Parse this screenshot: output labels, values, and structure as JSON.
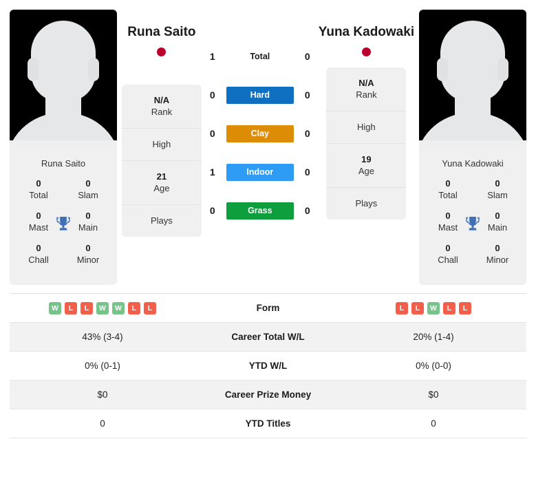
{
  "players": {
    "left": {
      "name": "Runa Saito",
      "photo_caption": "Runa Saito",
      "flag_name": "japan-flag",
      "flag_color": "#bc002d",
      "titles": [
        {
          "num": "0",
          "label": "Total"
        },
        {
          "num": "0",
          "label": "Slam"
        },
        {
          "num": "0",
          "label": "Mast"
        },
        {
          "num": "0",
          "label": "Main"
        },
        {
          "num": "0",
          "label": "Chall"
        },
        {
          "num": "0",
          "label": "Minor"
        }
      ],
      "info": [
        {
          "value": "N/A",
          "label": "Rank"
        },
        {
          "value": "",
          "label": "High"
        },
        {
          "value": "21",
          "label": "Age"
        },
        {
          "value": "",
          "label": "Plays"
        }
      ]
    },
    "right": {
      "name": "Yuna Kadowaki",
      "photo_caption": "Yuna Kadowaki",
      "flag_name": "japan-flag",
      "flag_color": "#bc002d",
      "titles": [
        {
          "num": "0",
          "label": "Total"
        },
        {
          "num": "0",
          "label": "Slam"
        },
        {
          "num": "0",
          "label": "Mast"
        },
        {
          "num": "0",
          "label": "Main"
        },
        {
          "num": "0",
          "label": "Chall"
        },
        {
          "num": "0",
          "label": "Minor"
        }
      ],
      "info": [
        {
          "value": "N/A",
          "label": "Rank"
        },
        {
          "value": "",
          "label": "High"
        },
        {
          "value": "19",
          "label": "Age"
        },
        {
          "value": "",
          "label": "Plays"
        }
      ]
    }
  },
  "surfaces": [
    {
      "label": "Total",
      "left": "1",
      "right": "0",
      "color": "transparent",
      "text_color": "#1b1b1b"
    },
    {
      "label": "Hard",
      "left": "0",
      "right": "0",
      "color": "#0f6fc0",
      "text_color": "#ffffff"
    },
    {
      "label": "Clay",
      "left": "0",
      "right": "0",
      "color": "#dd8c06",
      "text_color": "#ffffff"
    },
    {
      "label": "Indoor",
      "left": "1",
      "right": "0",
      "color": "#2e9bf5",
      "text_color": "#ffffff"
    },
    {
      "label": "Grass",
      "left": "0",
      "right": "0",
      "color": "#0e9e3e",
      "text_color": "#ffffff"
    }
  ],
  "stats_rows": [
    {
      "label": "Form",
      "type": "form",
      "left_form": [
        "W",
        "L",
        "L",
        "W",
        "W",
        "L",
        "L"
      ],
      "right_form": [
        "L",
        "L",
        "W",
        "L",
        "L"
      ],
      "left": "",
      "right": ""
    },
    {
      "label": "Career Total W/L",
      "type": "text",
      "left": "43% (3-4)",
      "right": "20% (1-4)"
    },
    {
      "label": "YTD W/L",
      "type": "text",
      "left": "0% (0-1)",
      "right": "0% (0-0)"
    },
    {
      "label": "Career Prize Money",
      "type": "text",
      "left": "$0",
      "right": "$0"
    },
    {
      "label": "YTD Titles",
      "type": "text",
      "left": "0",
      "right": "0"
    }
  ],
  "colors": {
    "form_win": "#77c48a",
    "form_loss": "#f2604c",
    "trophy": "#3f6fb5",
    "card_bg": "#f0f0f0"
  }
}
